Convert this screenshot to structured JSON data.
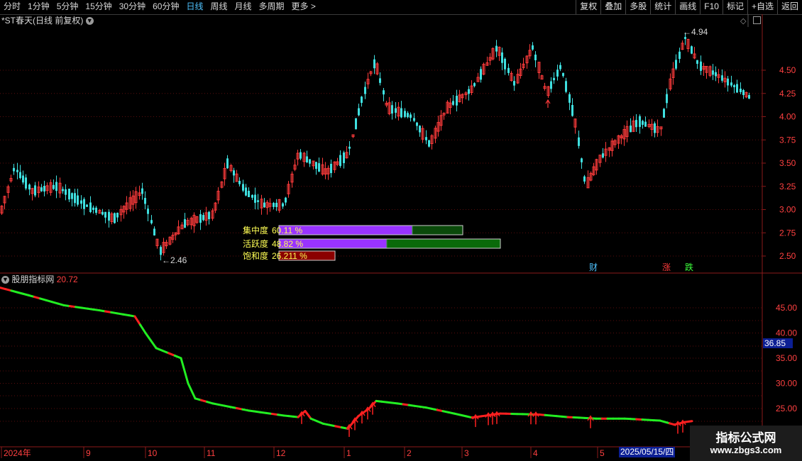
{
  "toolbar": {
    "periods": [
      "分时",
      "1分钟",
      "5分钟",
      "15分钟",
      "30分钟",
      "60分钟",
      "日线",
      "周线",
      "月线",
      "多周期",
      "更多 >"
    ],
    "active_period": "日线",
    "tools": [
      "复权",
      "叠加",
      "多股",
      "统计",
      "画线",
      "F10",
      "标记",
      "+自选",
      "返回"
    ]
  },
  "main_chart": {
    "title": "*ST春天(日线 前复权)",
    "price_axis": [
      "4.50",
      "4.25",
      "4.00",
      "3.75",
      "3.50",
      "3.25",
      "3.00",
      "2.75",
      "2.50"
    ],
    "high_label": "4.94",
    "low_label": "2.46",
    "markers": [
      "财",
      "涨",
      "跌"
    ],
    "marker_colors": {
      "财": "#4fc3ff",
      "涨": "#ff3b3b",
      "跌": "#3bff3b"
    }
  },
  "chip_panel": [
    {
      "label": "集中度",
      "value": "60.11 %",
      "fill": 0.607,
      "color": "#9933ff",
      "rest_color": "#0a4a0a"
    },
    {
      "label": "活跃度",
      "value": "48.82 %",
      "fill": 0.488,
      "color": "#9933ff",
      "rest_color": "#0a6a0a"
    },
    {
      "label": "饱和度",
      "value": "26.211 %",
      "fill": 1.0,
      "color": "#8b0000",
      "rest_color": "#8b0000"
    }
  ],
  "indicator": {
    "name": "股朋指标网",
    "value": "20.72",
    "value_tag": "36.85",
    "axis": [
      "45.00",
      "40.00",
      "35.00",
      "30.00",
      "25.00"
    ]
  },
  "date_axis": [
    "2024年",
    "9",
    "10",
    "11",
    "12",
    "1",
    "2",
    "3",
    "4",
    "5"
  ],
  "date_badge": "2025/05/15/四",
  "watermark": {
    "title": "指标公式网",
    "url": "www.zbgs3.com"
  },
  "chart_data": {
    "type": "line",
    "title": "*ST春天(日线 前复权)",
    "x": [
      "2024年",
      "9",
      "10",
      "11",
      "12",
      "1",
      "2",
      "3",
      "4",
      "5"
    ],
    "series": [
      {
        "name": "股朋指标网",
        "values": [
          49.0,
          45.5,
          44.0,
          27.0,
          23.0,
          21.5,
          26.5,
          24.0,
          23.5,
          23.0,
          21.0
        ]
      }
    ],
    "price_range": [
      2.46,
      4.94
    ],
    "indicator_range": [
      20.72,
      49.0
    ]
  }
}
